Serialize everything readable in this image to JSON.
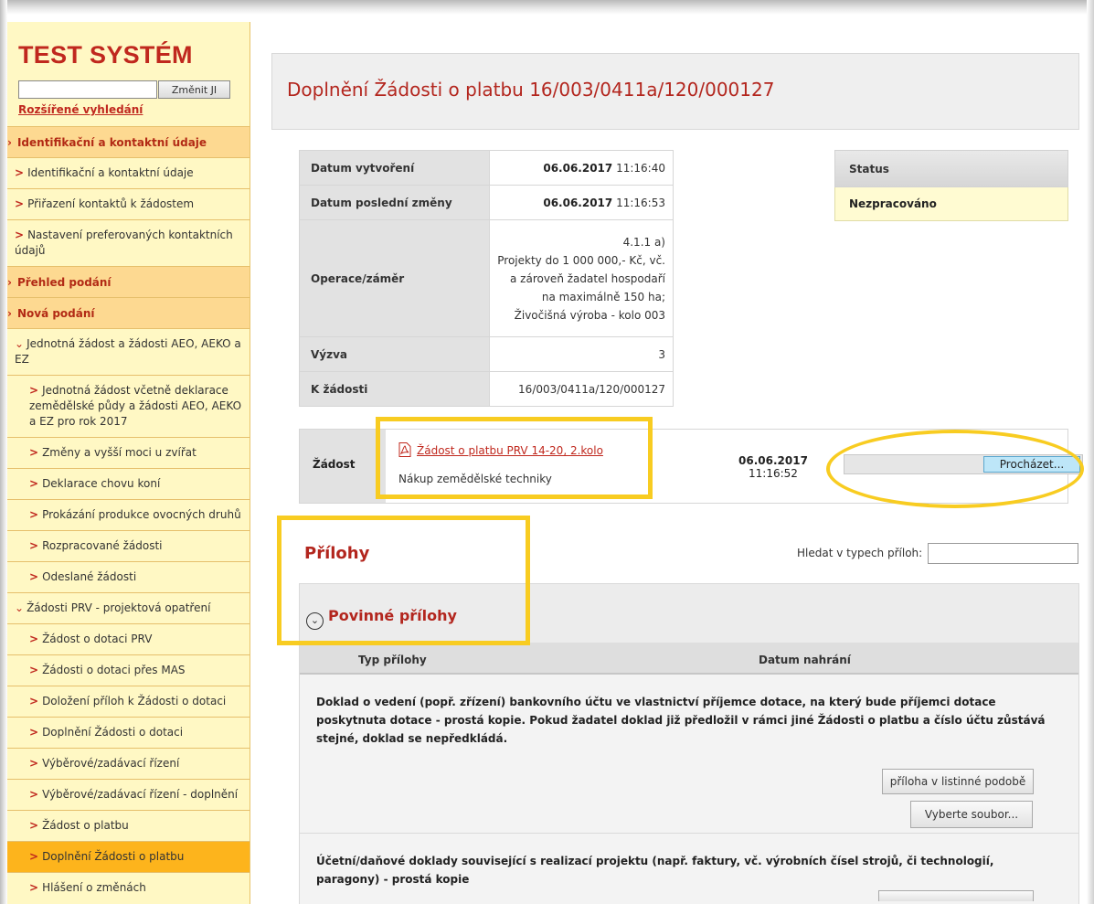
{
  "sidebar": {
    "brand": "TEST SYSTÉM",
    "search_button": "Změnit JI",
    "advanced_search": "Rozšířené vyhledání",
    "items": [
      {
        "label": "Identifikační a kontaktní údaje"
      },
      {
        "label": "Identifikační a kontaktní údaje"
      },
      {
        "label": "Přiřazení kontaktů k žádostem"
      },
      {
        "label": "Nastavení preferovaných kontaktních údajů"
      },
      {
        "label": "Přehled podání"
      },
      {
        "label": "Nová podání"
      },
      {
        "label": "Jednotná žádost a žádosti AEO, AEKO a EZ"
      },
      {
        "label": "Jednotná žádost včetně deklarace zemědělské půdy a žádosti AEO, AEKO a EZ pro rok 2017"
      },
      {
        "label": "Změny a vyšší moci u zvířat"
      },
      {
        "label": "Deklarace chovu koní"
      },
      {
        "label": "Prokázání produkce ovocných druhů"
      },
      {
        "label": "Rozpracované žádosti"
      },
      {
        "label": "Odeslané žádosti"
      },
      {
        "label": "Žádosti PRV - projektová opatření"
      },
      {
        "label": "Žádost o dotaci PRV"
      },
      {
        "label": "Žádosti o dotaci přes MAS"
      },
      {
        "label": "Doložení příloh k Žádosti o dotaci"
      },
      {
        "label": "Doplnění Žádosti o dotaci"
      },
      {
        "label": "Výběrové/zadávací řízení"
      },
      {
        "label": "Výběrové/zadávací řízení - doplnění"
      },
      {
        "label": "Žádost o platbu"
      },
      {
        "label": "Doplnění Žádosti o platbu"
      },
      {
        "label": "Hlášení o změnách"
      }
    ]
  },
  "page": {
    "title": "Doplnění Žádosti o platbu 16/003/0411a/120/000127"
  },
  "info": {
    "created_label": "Datum vytvoření",
    "created_date": "06.06.2017",
    "created_time": "11:16:40",
    "modified_label": "Datum poslední změny",
    "modified_date": "06.06.2017",
    "modified_time": "11:16:53",
    "operation_label": "Operace/záměr",
    "operation_lines": [
      "4.1.1 a)",
      "Projekty do 1 000 000,- Kč, vč.",
      "a zároveň žadatel hospodaří",
      "na maximálně 150 ha;",
      "Živočišná výroba - kolo 003"
    ],
    "call_label": "Výzva",
    "call_value": "3",
    "request_label": "K žádosti",
    "request_value": "16/003/0411a/120/000127"
  },
  "status": {
    "label": "Status",
    "value": "Nezpracováno"
  },
  "zadost": {
    "label": "Žádost",
    "doc_link": "Žádost o platbu PRV 14-20, 2.kolo",
    "doc_desc": "Nákup zemědělské techniky",
    "date": "06.06.2017",
    "time": "11:16:52",
    "browse_button": "Procházet..."
  },
  "attachments": {
    "title": "Přílohy",
    "search_label": "Hledat v typech příloh:",
    "section_title": "Povinné přílohy",
    "col_type": "Typ přílohy",
    "col_date": "Datum nahrání",
    "items": [
      {
        "text": "Doklad o vedení (popř. zřízení) bankovního účtu ve vlastnictví příjemce dotace, na který bude příjemci dotace poskytnuta dotace - prostá kopie. Pokud žadatel doklad již předložil v rámci jiné Žádosti o platbu a číslo účtu zůstává stejné, doklad se nepředkládá.",
        "paper_button": "příloha v listinné podobě",
        "file_button": "Vyberte soubor..."
      },
      {
        "text": "Účetní/daňové doklady související s realizací projektu (např. faktury, vč. výrobních čísel strojů, či technologií, paragony) - prostá kopie"
      }
    ]
  },
  "colors": {
    "accent_red": "#c0281e",
    "sidebar_bg": "#fff8c4",
    "sidebar_selected": "#fdb41c",
    "highlight_yellow": "#f8cc21"
  }
}
